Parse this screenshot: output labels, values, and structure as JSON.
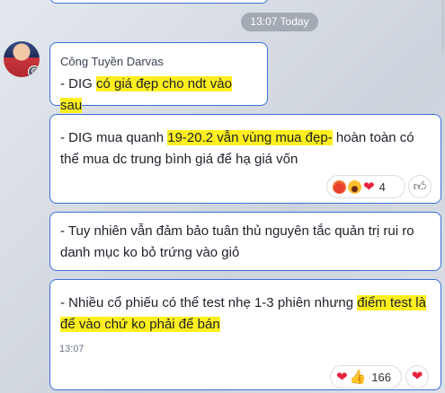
{
  "separator": {
    "time": "13:07 Today"
  },
  "sender": {
    "name": "Công Tuyền Darvas"
  },
  "messages": [
    {
      "pre": "- DIG ",
      "highlight": "có giá đẹp cho ndt vào sau",
      "post": ""
    },
    {
      "pre": "- DIG mua quanh ",
      "highlight": "19-20.2 vẫn vùng mua đẹp-",
      "post": " hoàn toàn có thể mua dc trung bình giá để hạ giá vốn",
      "reactions": {
        "icons": [
          "angry-emoji",
          "haha-emoji",
          "heart-icon"
        ],
        "count": "4"
      }
    },
    {
      "text": "- Tuy nhiên vẫn đảm bảo tuân thủ nguyên tắc quản trị rui ro danh mục ko bỏ trứng vào giỏ"
    },
    {
      "pre": "- Nhiều cổ phiếu có thể test nhẹ 1-3 phiên nhưng ",
      "highlight": "điểm test là để vào chứ ko phải để bán",
      "post": "",
      "time": "13:07",
      "reactions": {
        "icons": [
          "heart-icon",
          "thumbs-up-icon"
        ],
        "count": "166"
      }
    }
  ],
  "colors": {
    "bubble_border": "#3b6fd8",
    "highlight": "#ffef1e",
    "heart": "#e8243d"
  }
}
